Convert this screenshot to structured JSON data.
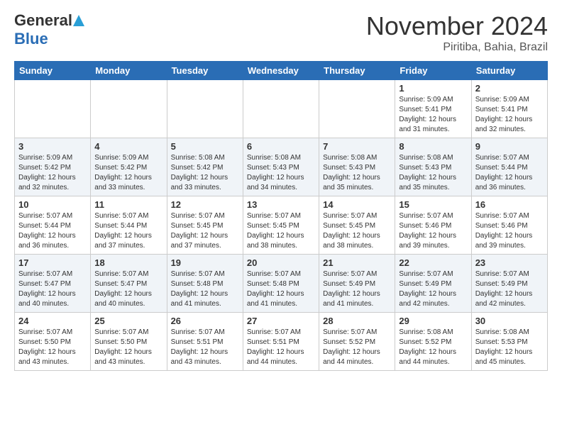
{
  "logo": {
    "general": "General",
    "blue": "Blue"
  },
  "title": "November 2024",
  "location": "Piritiba, Bahia, Brazil",
  "weekdays": [
    "Sunday",
    "Monday",
    "Tuesday",
    "Wednesday",
    "Thursday",
    "Friday",
    "Saturday"
  ],
  "weeks": [
    [
      {
        "day": "",
        "content": ""
      },
      {
        "day": "",
        "content": ""
      },
      {
        "day": "",
        "content": ""
      },
      {
        "day": "",
        "content": ""
      },
      {
        "day": "",
        "content": ""
      },
      {
        "day": "1",
        "content": "Sunrise: 5:09 AM\nSunset: 5:41 PM\nDaylight: 12 hours\nand 31 minutes."
      },
      {
        "day": "2",
        "content": "Sunrise: 5:09 AM\nSunset: 5:41 PM\nDaylight: 12 hours\nand 32 minutes."
      }
    ],
    [
      {
        "day": "3",
        "content": "Sunrise: 5:09 AM\nSunset: 5:42 PM\nDaylight: 12 hours\nand 32 minutes."
      },
      {
        "day": "4",
        "content": "Sunrise: 5:09 AM\nSunset: 5:42 PM\nDaylight: 12 hours\nand 33 minutes."
      },
      {
        "day": "5",
        "content": "Sunrise: 5:08 AM\nSunset: 5:42 PM\nDaylight: 12 hours\nand 33 minutes."
      },
      {
        "day": "6",
        "content": "Sunrise: 5:08 AM\nSunset: 5:43 PM\nDaylight: 12 hours\nand 34 minutes."
      },
      {
        "day": "7",
        "content": "Sunrise: 5:08 AM\nSunset: 5:43 PM\nDaylight: 12 hours\nand 35 minutes."
      },
      {
        "day": "8",
        "content": "Sunrise: 5:08 AM\nSunset: 5:43 PM\nDaylight: 12 hours\nand 35 minutes."
      },
      {
        "day": "9",
        "content": "Sunrise: 5:07 AM\nSunset: 5:44 PM\nDaylight: 12 hours\nand 36 minutes."
      }
    ],
    [
      {
        "day": "10",
        "content": "Sunrise: 5:07 AM\nSunset: 5:44 PM\nDaylight: 12 hours\nand 36 minutes."
      },
      {
        "day": "11",
        "content": "Sunrise: 5:07 AM\nSunset: 5:44 PM\nDaylight: 12 hours\nand 37 minutes."
      },
      {
        "day": "12",
        "content": "Sunrise: 5:07 AM\nSunset: 5:45 PM\nDaylight: 12 hours\nand 37 minutes."
      },
      {
        "day": "13",
        "content": "Sunrise: 5:07 AM\nSunset: 5:45 PM\nDaylight: 12 hours\nand 38 minutes."
      },
      {
        "day": "14",
        "content": "Sunrise: 5:07 AM\nSunset: 5:45 PM\nDaylight: 12 hours\nand 38 minutes."
      },
      {
        "day": "15",
        "content": "Sunrise: 5:07 AM\nSunset: 5:46 PM\nDaylight: 12 hours\nand 39 minutes."
      },
      {
        "day": "16",
        "content": "Sunrise: 5:07 AM\nSunset: 5:46 PM\nDaylight: 12 hours\nand 39 minutes."
      }
    ],
    [
      {
        "day": "17",
        "content": "Sunrise: 5:07 AM\nSunset: 5:47 PM\nDaylight: 12 hours\nand 40 minutes."
      },
      {
        "day": "18",
        "content": "Sunrise: 5:07 AM\nSunset: 5:47 PM\nDaylight: 12 hours\nand 40 minutes."
      },
      {
        "day": "19",
        "content": "Sunrise: 5:07 AM\nSunset: 5:48 PM\nDaylight: 12 hours\nand 41 minutes."
      },
      {
        "day": "20",
        "content": "Sunrise: 5:07 AM\nSunset: 5:48 PM\nDaylight: 12 hours\nand 41 minutes."
      },
      {
        "day": "21",
        "content": "Sunrise: 5:07 AM\nSunset: 5:49 PM\nDaylight: 12 hours\nand 41 minutes."
      },
      {
        "day": "22",
        "content": "Sunrise: 5:07 AM\nSunset: 5:49 PM\nDaylight: 12 hours\nand 42 minutes."
      },
      {
        "day": "23",
        "content": "Sunrise: 5:07 AM\nSunset: 5:49 PM\nDaylight: 12 hours\nand 42 minutes."
      }
    ],
    [
      {
        "day": "24",
        "content": "Sunrise: 5:07 AM\nSunset: 5:50 PM\nDaylight: 12 hours\nand 43 minutes."
      },
      {
        "day": "25",
        "content": "Sunrise: 5:07 AM\nSunset: 5:50 PM\nDaylight: 12 hours\nand 43 minutes."
      },
      {
        "day": "26",
        "content": "Sunrise: 5:07 AM\nSunset: 5:51 PM\nDaylight: 12 hours\nand 43 minutes."
      },
      {
        "day": "27",
        "content": "Sunrise: 5:07 AM\nSunset: 5:51 PM\nDaylight: 12 hours\nand 44 minutes."
      },
      {
        "day": "28",
        "content": "Sunrise: 5:07 AM\nSunset: 5:52 PM\nDaylight: 12 hours\nand 44 minutes."
      },
      {
        "day": "29",
        "content": "Sunrise: 5:08 AM\nSunset: 5:52 PM\nDaylight: 12 hours\nand 44 minutes."
      },
      {
        "day": "30",
        "content": "Sunrise: 5:08 AM\nSunset: 5:53 PM\nDaylight: 12 hours\nand 45 minutes."
      }
    ]
  ]
}
